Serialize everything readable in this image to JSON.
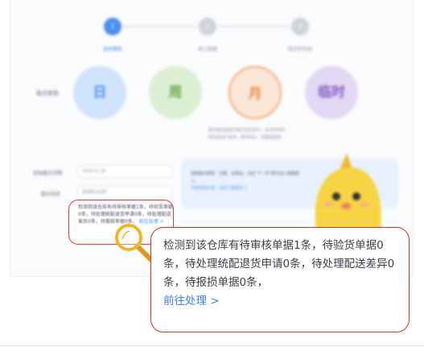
{
  "stepper": {
    "steps": [
      {
        "number": "1",
        "label": "选择模板"
      },
      {
        "number": "2",
        "label": "录入数据"
      },
      {
        "number": "3",
        "label": "提交并完成"
      }
    ]
  },
  "form": {
    "period_label": "盘点类型",
    "periods": [
      "日",
      "周",
      "月",
      "临时"
    ],
    "help_text": "整仓盘点需结合盘点任务进行，会对所有库存商品进行盘点，耗时较长，请谨慎选择。",
    "date_label": "初始盘点日期",
    "date_value": "2020-11-18",
    "warehouse_label": "盘点仓库",
    "warehouse_value": "测试默认仓库"
  },
  "assistant_bubble": {
    "text": "选择盘点类型、日期、仓库后，点击“下一步”即可进入数据录入。",
    "link": "不知道怎么选，点这了解更多 >"
  },
  "warning": {
    "text": "检测到该仓库有待审核单据1条，待验货单据0条，待处理统配退货申请0条，待处理配送差异0条，待报损单据0条，",
    "link": "前往处理 >"
  },
  "callout": {
    "text": "检测到该仓库有待审核单据1条，待验货单据0条，待处理统配退货申请0条，待处理配送差异0条，待报损单据0条，",
    "link": "前往处理 >"
  },
  "colors": {
    "accent": "#4a8ef0",
    "highlight_border": "#d82c2c",
    "magnifier": "#f0b429"
  }
}
